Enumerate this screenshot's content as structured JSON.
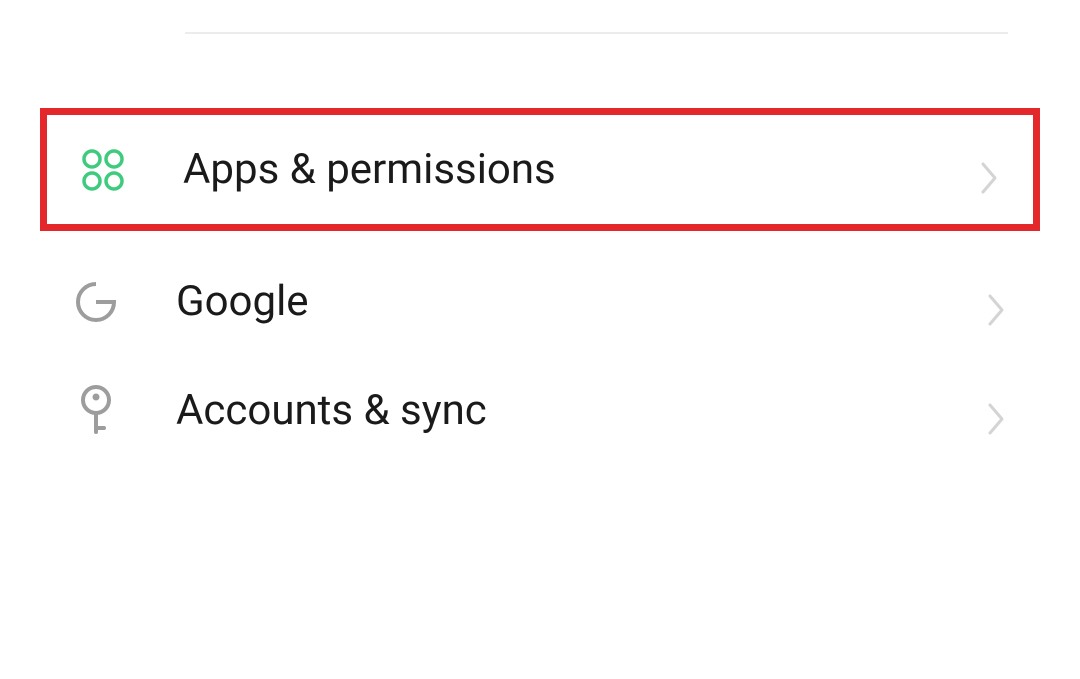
{
  "settings": {
    "items": [
      {
        "label": "Apps & permissions",
        "icon": "apps-icon",
        "highlighted": true
      },
      {
        "label": "Google",
        "icon": "google-icon",
        "highlighted": false
      },
      {
        "label": "Accounts & sync",
        "icon": "key-icon",
        "highlighted": false
      }
    ]
  },
  "colors": {
    "highlight_border": "#e3272b",
    "icon_green": "#3fcb7e",
    "icon_gray": "#9d9d9d",
    "chevron": "#cfcfcf",
    "text": "#1a1a1a"
  }
}
